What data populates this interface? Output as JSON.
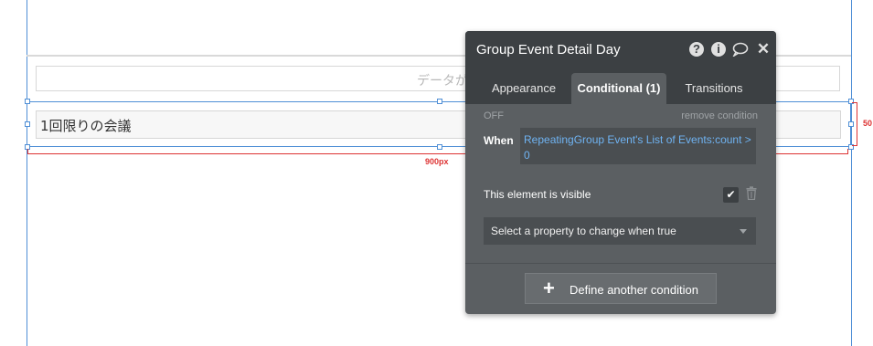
{
  "canvas": {
    "placeholder_text": "データがありま",
    "text_field_value": "1回限りの会議",
    "width_label": "900px",
    "height_label": "50"
  },
  "panel": {
    "title": "Group Event Detail Day",
    "header_icons": [
      "help-icon",
      "info-icon",
      "comment-icon",
      "close-icon"
    ],
    "tabs": [
      {
        "label": "Appearance",
        "active": false
      },
      {
        "label": "Conditional (1)",
        "active": true
      },
      {
        "label": "Transitions",
        "active": false
      }
    ],
    "condition": {
      "status": "OFF",
      "remove_label": "remove condition",
      "when_label": "When",
      "expression": "RepeatingGroup Event's List of Events:count > 0"
    },
    "visible_label": "This element is visible",
    "visible_checked": true,
    "property_dropdown": "Select a property to change when true",
    "define_button": "Define another condition"
  }
}
